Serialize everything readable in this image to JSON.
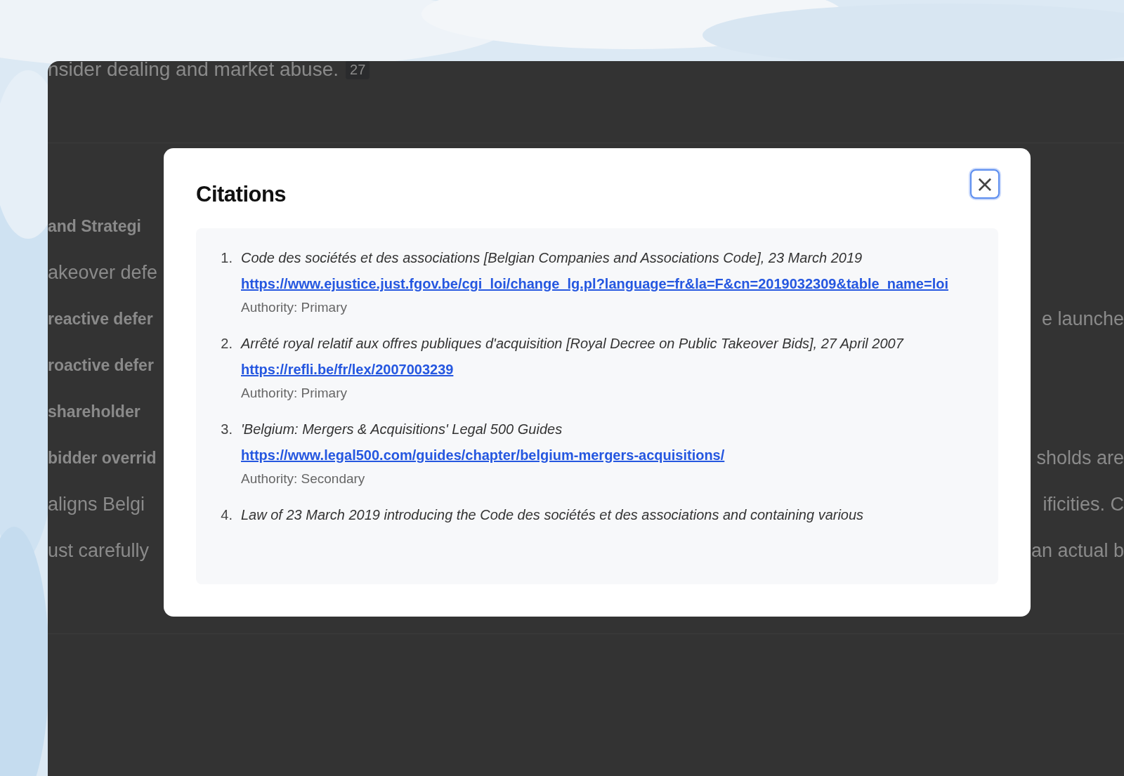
{
  "background_page": {
    "lines": [
      {
        "left": "nsider dealing and market abuse.",
        "badge": "27",
        "bold": false
      },
      {
        "left": "and Strategi",
        "bold": true
      },
      {
        "left": "akeover defe",
        "bold": false
      },
      {
        "left": "reactive defer",
        "right": "e launche",
        "bold": true
      },
      {
        "left": "roactive defer",
        "bold": true
      },
      {
        "left": "shareholder",
        "bold": true
      },
      {
        "left": "bidder overrid",
        "right": "sholds are",
        "bold": true
      },
      {
        "left": "aligns Belgi",
        "right": "ificities. C",
        "bold": false
      },
      {
        "left": "ust carefully",
        "right": "an actual b",
        "bold": false
      }
    ]
  },
  "dialog": {
    "title": "Citations",
    "close": "×",
    "citations": [
      {
        "number": "1.",
        "title": "Code des sociétés et des associations [Belgian Companies and Associations Code], 23 March 2019",
        "url": "https://www.ejustice.just.fgov.be/cgi_loi/change_lg.pl?language=fr&la=F&cn=2019032309&table_name=loi",
        "authority": "Authority: Primary"
      },
      {
        "number": "2.",
        "title": "Arrêté royal relatif aux offres publiques d'acquisition [Royal Decree on Public Takeover Bids], 27 April 2007",
        "url": "https://refli.be/fr/lex/2007003239",
        "authority": "Authority: Primary"
      },
      {
        "number": "3.",
        "title": "'Belgium: Mergers & Acquisitions' Legal 500 Guides",
        "url": "https://www.legal500.com/guides/chapter/belgium-mergers-acquisitions/",
        "authority": "Authority: Secondary"
      },
      {
        "number": "4.",
        "title": "Law of 23 March 2019 introducing the Code des sociétés et des associations and containing various"
      }
    ]
  }
}
